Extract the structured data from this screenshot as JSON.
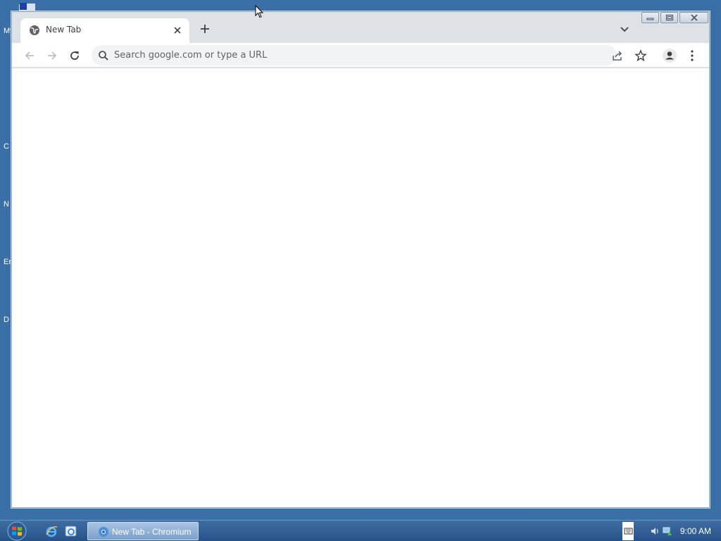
{
  "desktop": {
    "icon_fragments": [
      "My",
      "C",
      "N",
      "Er",
      "D"
    ]
  },
  "browser": {
    "tab": {
      "title": "New Tab"
    },
    "omnibox": {
      "placeholder": "Search google.com or type a URL"
    }
  },
  "taskbar": {
    "task_label": "New Tab - Chromium",
    "clock": "9:00 AM"
  },
  "colors": {
    "desktop": "#3b6fa8",
    "tabstrip": "#dee1e6",
    "omnibox": "#f1f3f4",
    "icon": "#5f6368"
  }
}
